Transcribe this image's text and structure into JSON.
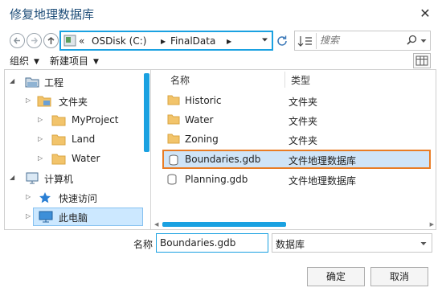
{
  "window": {
    "title": "修复地理数据库"
  },
  "address": {
    "overflow": "«",
    "segments": [
      "OSDisk (C:)",
      "FinalData"
    ]
  },
  "search": {
    "placeholder": "搜索"
  },
  "toolbar": {
    "organize": "组织",
    "new_item": "新建项目"
  },
  "tree": [
    {
      "label": "工程",
      "icon": "project-icon",
      "level": 0,
      "expand": "collapse",
      "selected": false
    },
    {
      "label": "文件夹",
      "icon": "folder-icon",
      "level": 1,
      "expand": "expand",
      "selected": false
    },
    {
      "label": "MyProject",
      "icon": "folder-icon",
      "level": 2,
      "expand": "expand",
      "selected": false
    },
    {
      "label": "Land",
      "icon": "folder-icon",
      "level": 2,
      "expand": "expand",
      "selected": false
    },
    {
      "label": "Water",
      "icon": "folder-icon",
      "level": 2,
      "expand": "expand",
      "selected": false
    },
    {
      "label": "计算机",
      "icon": "computer-icon",
      "level": 0,
      "expand": "collapse",
      "selected": false
    },
    {
      "label": "快速访问",
      "icon": "star-icon",
      "level": 1,
      "expand": "expand",
      "selected": false
    },
    {
      "label": "此电脑",
      "icon": "pc-icon",
      "level": 1,
      "expand": "expand",
      "selected": true
    }
  ],
  "list": {
    "columns": {
      "name": "名称",
      "type": "类型"
    },
    "rows": [
      {
        "name": "Historic",
        "type": "文件夹",
        "icon": "folder-icon",
        "selected": false
      },
      {
        "name": "Water",
        "type": "文件夹",
        "icon": "folder-icon",
        "selected": false
      },
      {
        "name": "Zoning",
        "type": "文件夹",
        "icon": "folder-icon",
        "selected": false
      },
      {
        "name": "Boundaries.gdb",
        "type": "文件地理数据库",
        "icon": "database-icon",
        "selected": true
      },
      {
        "name": "Planning.gdb",
        "type": "文件地理数据库",
        "icon": "database-icon",
        "selected": false
      }
    ]
  },
  "form": {
    "name_label": "名称",
    "name_value": "Boundaries.gdb",
    "type_value": "数据库"
  },
  "buttons": {
    "ok": "确定",
    "cancel": "取消"
  },
  "colors": {
    "accent": "#1aa1e1",
    "selection_outline": "#e97c24",
    "folder": "#f2c46b",
    "title": "#1f4e79"
  }
}
